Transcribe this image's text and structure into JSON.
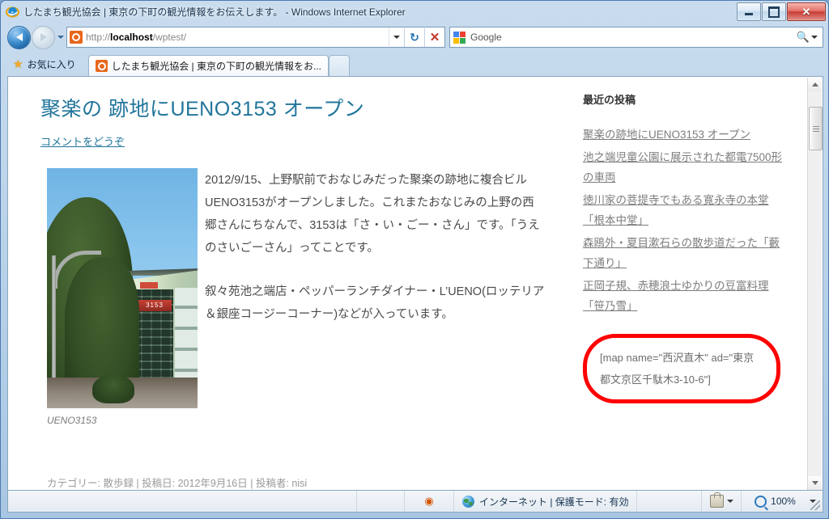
{
  "window": {
    "title": "したまち観光協会 | 東京の下町の観光情報をお伝えします。 - Windows Internet Explorer",
    "minimize_label": "最小化",
    "maximize_label": "最大化",
    "close_label": "✕"
  },
  "toolbar": {
    "back_label": "戻る",
    "forward_label": "進む",
    "recent_pages_label": "最近表示したページ",
    "url": "http://localhost/wptest/",
    "url_bold": "localhost",
    "url_prefix": "http://",
    "url_suffix": "/wptest/",
    "refresh_label": "最新の情報に更新",
    "stop_label": "中止",
    "search_value": "Google",
    "search_placeholder": "検索"
  },
  "favorites": {
    "label": "お気に入り"
  },
  "tabs": [
    {
      "label": "したまち観光協会 | 東京の下町の観光情報をお..."
    }
  ],
  "new_tab_label": "新しいタブ",
  "page": {
    "post_title": "聚楽の 跡地にUENO3153 オープン",
    "comment_link": "コメントをどうぞ",
    "photo_caption": "UENO3153",
    "paragraphs": [
      "2012/9/15、上野駅前でおなじみだった聚楽の跡地に複合ビルUENO3153がオープンしました。これまたおなじみの上野の西郷さんにちなんで、3153は「さ・い・ごー・さん」です。「うえのさいごーさん」ってことです。",
      "叙々苑池之端店・ペッパーランチダイナー・L’UENO(ロッテリア＆銀座コージーコーナー)などが入っています。"
    ],
    "meta": "カテゴリー: 散歩録 | 投稿日: 2012年9月16日 | 投稿者: nisi",
    "sidebar": {
      "title": "最近の投稿",
      "links": [
        "聚楽の跡地にUENO3153 オープン",
        "池之端児童公園に展示された都電7500形の車両",
        "徳川家の菩提寺でもある寛永寺の本堂「根本中堂」",
        "森鴎外・夏目漱石らの散歩道だった「藪下通り」",
        "正岡子規、赤穂浪士ゆかりの豆富料理「笹乃雪」"
      ]
    },
    "shortcode": "[map name=\"西沢直木\" ad=\"東京都文京区千駄木3-10-6\"]",
    "highlight_color": "#ff0000"
  },
  "statusbar": {
    "zone": "インターネット | 保護モード: 有効",
    "zoom": "100%"
  }
}
